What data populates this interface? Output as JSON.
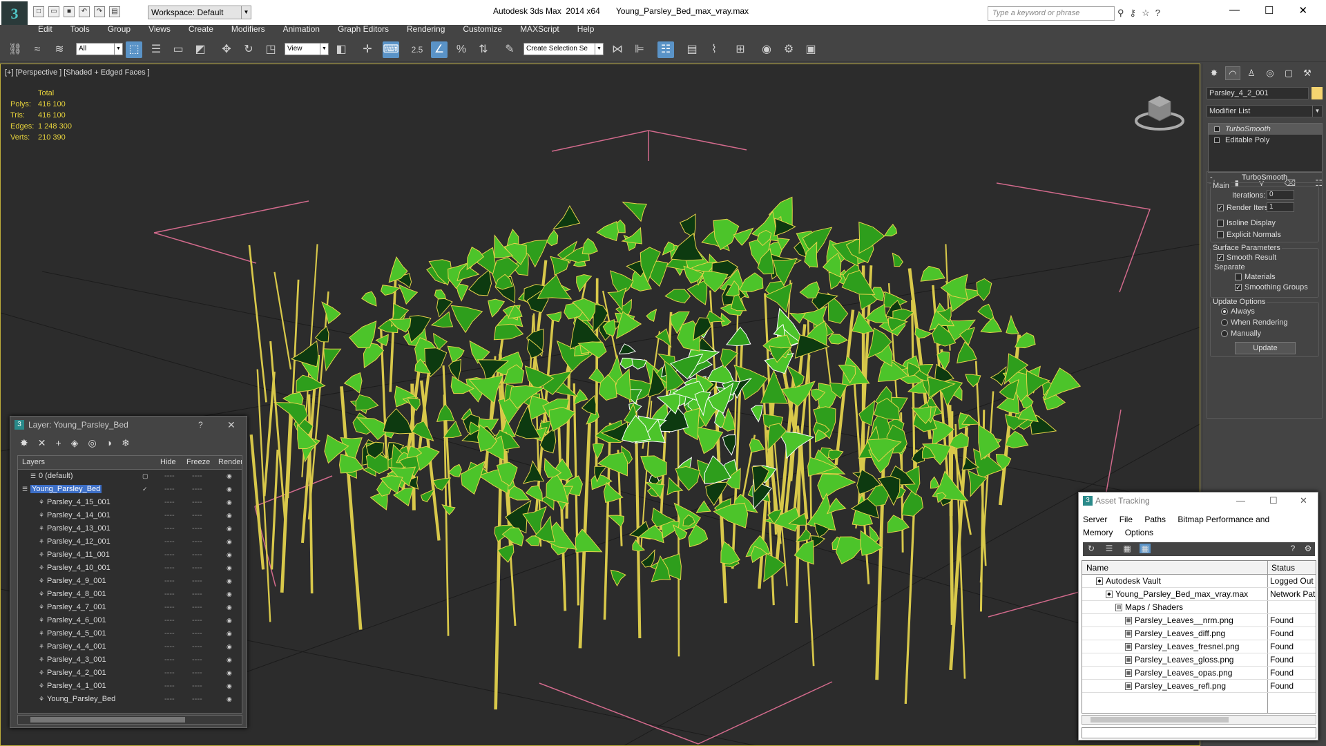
{
  "app": {
    "title": "Autodesk 3ds Max  2014 x64       Young_Parsley_Bed_max_vray.max",
    "logo": "3"
  },
  "workspace": {
    "label": "Workspace: Default"
  },
  "search": {
    "placeholder": "Type a keyword or phrase"
  },
  "menu": [
    "Edit",
    "Tools",
    "Group",
    "Views",
    "Create",
    "Modifiers",
    "Animation",
    "Graph Editors",
    "Rendering",
    "Customize",
    "MAXScript",
    "Help"
  ],
  "toolbar": {
    "filter": "All",
    "refcoord": "View",
    "snap_value": "2.5",
    "selection_set": "Create Selection Se"
  },
  "viewport": {
    "label": "[+] [Perspective ] [Shaded + Edged Faces ]",
    "stats": {
      "total_label": "Total",
      "rows": [
        {
          "k": "Polys:",
          "v": "416 100"
        },
        {
          "k": "Tris:",
          "v": "416 100"
        },
        {
          "k": "Edges:",
          "v": "1 248 300"
        },
        {
          "k": "Verts:",
          "v": "210 390"
        }
      ]
    }
  },
  "command_panel": {
    "object_name": "Parsley_4_2_001",
    "object_color": "#f4d470",
    "modifier_list": "Modifier List",
    "stack": [
      "TurboSmooth",
      "Editable Poly"
    ],
    "turbosmooth": {
      "title": "TurboSmooth",
      "main": "Main",
      "iterations_label": "Iterations:",
      "iterations": "0",
      "render_iters_label": "Render Iters:",
      "render_iters": "1",
      "isoline": "Isoline Display",
      "explicit_normals": "Explicit Normals",
      "surface_params": "Surface Parameters",
      "smooth_result": "Smooth Result",
      "separate": "Separate",
      "materials": "Materials",
      "smoothing_groups": "Smoothing Groups",
      "update_options": "Update Options",
      "always": "Always",
      "when_rendering": "When Rendering",
      "manually": "Manually",
      "update": "Update"
    }
  },
  "layer_window": {
    "title": "Layer: Young_Parsley_Bed",
    "help": "?",
    "columns": {
      "layers": "Layers",
      "hide": "Hide",
      "freeze": "Freeze",
      "render": "Render"
    },
    "rows": [
      {
        "name": "0 (default)",
        "indent": 1
      },
      {
        "name": "Young_Parsley_Bed",
        "indent": 0,
        "selected": true
      },
      {
        "name": "Parsley_4_15_001",
        "indent": 2
      },
      {
        "name": "Parsley_4_14_001",
        "indent": 2
      },
      {
        "name": "Parsley_4_13_001",
        "indent": 2
      },
      {
        "name": "Parsley_4_12_001",
        "indent": 2
      },
      {
        "name": "Parsley_4_11_001",
        "indent": 2
      },
      {
        "name": "Parsley_4_10_001",
        "indent": 2
      },
      {
        "name": "Parsley_4_9_001",
        "indent": 2
      },
      {
        "name": "Parsley_4_8_001",
        "indent": 2
      },
      {
        "name": "Parsley_4_7_001",
        "indent": 2
      },
      {
        "name": "Parsley_4_6_001",
        "indent": 2
      },
      {
        "name": "Parsley_4_5_001",
        "indent": 2
      },
      {
        "name": "Parsley_4_4_001",
        "indent": 2
      },
      {
        "name": "Parsley_4_3_001",
        "indent": 2
      },
      {
        "name": "Parsley_4_2_001",
        "indent": 2
      },
      {
        "name": "Parsley_4_1_001",
        "indent": 2
      },
      {
        "name": "Young_Parsley_Bed",
        "indent": 2
      }
    ]
  },
  "asset_window": {
    "title": "Asset Tracking",
    "menu": [
      "Server",
      "File",
      "Paths",
      "Bitmap Performance and Memory",
      "Options"
    ],
    "columns": {
      "name": "Name",
      "status": "Status"
    },
    "rows": [
      {
        "name": "Autodesk Vault",
        "status": "Logged Out",
        "level": 1
      },
      {
        "name": "Young_Parsley_Bed_max_vray.max",
        "status": "Network Pat",
        "level": 2
      },
      {
        "name": "Maps / Shaders",
        "status": "",
        "level": 3
      },
      {
        "name": "Parsley_Leaves__nrm.png",
        "status": "Found",
        "level": 4
      },
      {
        "name": "Parsley_Leaves_diff.png",
        "status": "Found",
        "level": 4
      },
      {
        "name": "Parsley_Leaves_fresnel.png",
        "status": "Found",
        "level": 4
      },
      {
        "name": "Parsley_Leaves_gloss.png",
        "status": "Found",
        "level": 4
      },
      {
        "name": "Parsley_Leaves_opas.png",
        "status": "Found",
        "level": 4
      },
      {
        "name": "Parsley_Leaves_refl.png",
        "status": "Found",
        "level": 4
      }
    ]
  }
}
